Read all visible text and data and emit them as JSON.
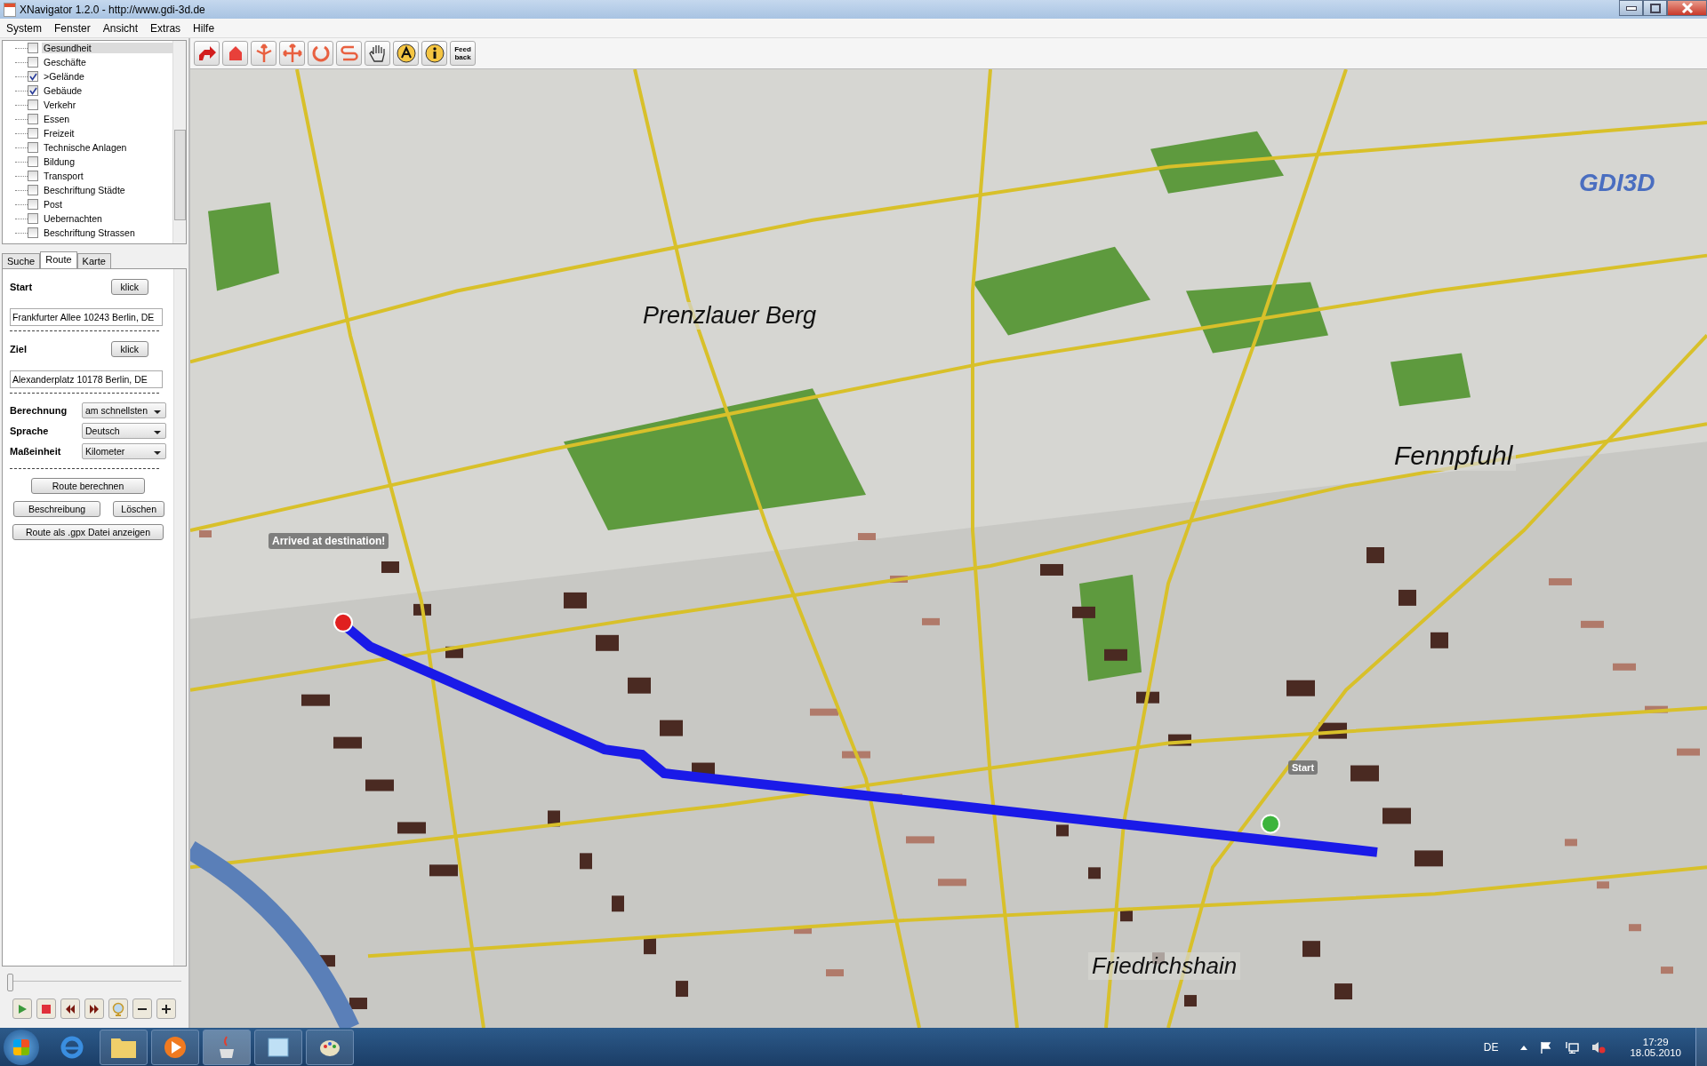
{
  "window": {
    "title": "XNavigator 1.2.0 - http://www.gdi-3d.de"
  },
  "menu": [
    "System",
    "Fenster",
    "Ansicht",
    "Extras",
    "Hilfe"
  ],
  "layers": [
    {
      "label": "Gesundheit",
      "checked": false,
      "selected": true
    },
    {
      "label": "Geschäfte",
      "checked": false,
      "selected": false
    },
    {
      "label": ">Gelände",
      "checked": true,
      "selected": false
    },
    {
      "label": "Gebäude",
      "checked": true,
      "selected": false
    },
    {
      "label": "Verkehr",
      "checked": false,
      "selected": false
    },
    {
      "label": "Essen",
      "checked": false,
      "selected": false
    },
    {
      "label": "Freizeit",
      "checked": false,
      "selected": false
    },
    {
      "label": "Technische Anlagen",
      "checked": false,
      "selected": false
    },
    {
      "label": "Bildung",
      "checked": false,
      "selected": false
    },
    {
      "label": "Transport",
      "checked": false,
      "selected": false
    },
    {
      "label": "Beschriftung Städte",
      "checked": false,
      "selected": false
    },
    {
      "label": "Post",
      "checked": false,
      "selected": false
    },
    {
      "label": "Uebernachten",
      "checked": false,
      "selected": false
    },
    {
      "label": "Beschriftung Strassen",
      "checked": false,
      "selected": false
    }
  ],
  "tabs": [
    {
      "label": "Suche",
      "selected": false
    },
    {
      "label": "Route",
      "selected": true
    },
    {
      "label": "Karte",
      "selected": false
    }
  ],
  "route": {
    "start": {
      "label": "Start",
      "button": "klick",
      "value": "Frankfurter Allee 10243 Berlin, DE"
    },
    "ziel": {
      "label": "Ziel",
      "button": "klick",
      "value": "Alexanderplatz 10178 Berlin, DE"
    },
    "options": [
      {
        "label": "Berechnung",
        "value": "am schnellsten"
      },
      {
        "label": "Sprache",
        "value": "Deutsch"
      },
      {
        "label": "Maßeinheit",
        "value": "Kilometer"
      }
    ],
    "calculate": "Route berechnen",
    "describe": "Beschreibung",
    "delete": "Löschen",
    "gpx": "Route als .gpx Datei anzeigen"
  },
  "playback": {
    "level": 0
  },
  "toolbar": {
    "feedback": "Feed back"
  },
  "map": {
    "logo": "GDI3D",
    "districts": [
      "Prenzlauer Berg",
      "Fennpfuhl",
      "Friedrichshain"
    ],
    "arrived": "Arrived at destination!",
    "start_tag": "Start"
  },
  "taskbar": {
    "language": "DE",
    "time": "17:29",
    "date": "18.05.2010"
  }
}
